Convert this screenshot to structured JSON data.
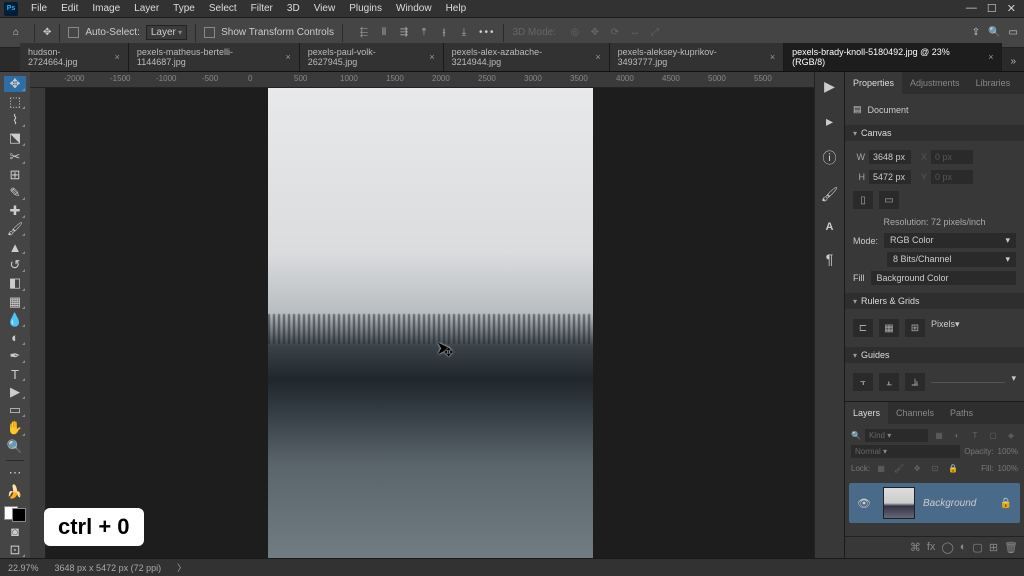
{
  "menu": [
    "File",
    "Edit",
    "Image",
    "Layer",
    "Type",
    "Select",
    "Filter",
    "3D",
    "View",
    "Plugins",
    "Window",
    "Help"
  ],
  "optbar": {
    "auto_select_label": "Auto-Select:",
    "auto_select_kind": "Layer",
    "show_controls": "Show Transform Controls",
    "mode3d": "3D Mode:"
  },
  "tabs": [
    {
      "label": "hudson-2724664.jpg",
      "active": false
    },
    {
      "label": "pexels-matheus-bertelli-1144687.jpg",
      "active": false
    },
    {
      "label": "pexels-paul-volk-2627945.jpg",
      "active": false
    },
    {
      "label": "pexels-alex-azabache-3214944.jpg",
      "active": false
    },
    {
      "label": "pexels-aleksey-kuprikov-3493777.jpg",
      "active": false
    },
    {
      "label": "pexels-brady-knoll-5180492.jpg @ 23% (RGB/8)",
      "active": true
    }
  ],
  "ruler_h": [
    "-2000",
    "-1500",
    "-1000",
    "-500",
    "0",
    "500",
    "1000",
    "1500",
    "2000",
    "2500",
    "3000",
    "3500",
    "4000",
    "4500",
    "5000",
    "5500"
  ],
  "properties": {
    "tabs": [
      "Properties",
      "Adjustments",
      "Libraries"
    ],
    "doc_label": "Document",
    "canvas_head": "Canvas",
    "w_label": "W",
    "w_val": "3648 px",
    "x_label": "X",
    "x_val": "0 px",
    "h_label": "H",
    "h_val": "5472 px",
    "y_label": "Y",
    "y_val": "0 px",
    "res": "Resolution: 72 pixels/inch",
    "mode_label": "Mode:",
    "mode_val": "RGB Color",
    "bits_val": "8 Bits/Channel",
    "fill_label": "Fill",
    "fill_val": "Background Color",
    "rulers_head": "Rulers & Grids",
    "rulers_unit": "Pixels",
    "guides_head": "Guides"
  },
  "layers": {
    "tabs": [
      "Layers",
      "Channels",
      "Paths"
    ],
    "search_placeholder": "Kind",
    "blend": "Normal",
    "opacity_label": "Opacity:",
    "opacity": "100%",
    "lock_label": "Lock:",
    "fill_label": "Fill:",
    "fill": "100%",
    "layer_name": "Background"
  },
  "status": {
    "zoom": "22.97%",
    "dims": "3648 px x 5472 px (72 ppi)"
  },
  "hint": "ctrl + 0"
}
